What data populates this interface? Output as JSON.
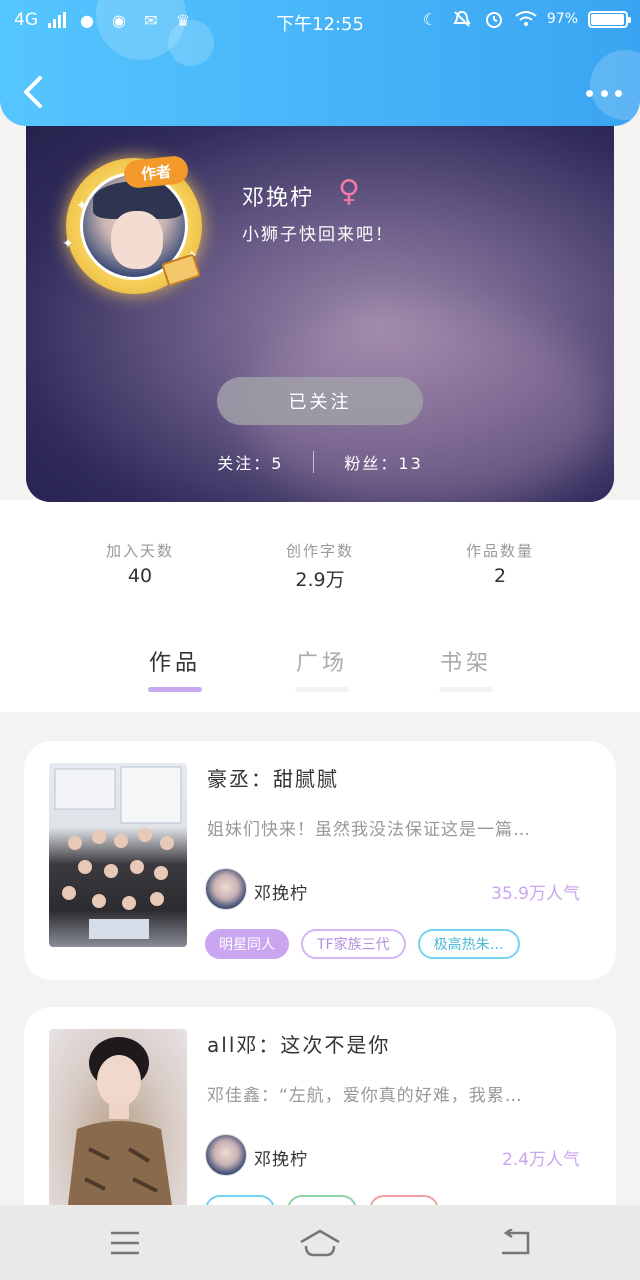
{
  "status_bar": {
    "network": "4G",
    "time": "下午12:55",
    "battery": "97%",
    "battery_level": 0.97
  },
  "header": {
    "back_icon": "chevron-left-icon",
    "more_icon": "ellipsis-icon"
  },
  "profile": {
    "author_badge": "作者",
    "name": "邓挽柠",
    "gender_symbol": "♀",
    "bio": "小狮子快回来吧！",
    "follow_button": "已关注",
    "following_label": "关注：5",
    "fans_label": "粉丝：13"
  },
  "stats": [
    {
      "label": "加入天数",
      "value": "40"
    },
    {
      "label": "创作字数",
      "value": "2.9万"
    },
    {
      "label": "作品数量",
      "value": "2"
    }
  ],
  "tabs": [
    {
      "label": "作品",
      "active": true
    },
    {
      "label": "广场",
      "active": false
    },
    {
      "label": "书架",
      "active": false
    }
  ],
  "works": [
    {
      "title": "豪丞：甜腻腻",
      "description": "姐妹们快来！虽然我没法保证这是一篇…",
      "author": "邓挽柠",
      "popularity": "35.9万人气",
      "tags": [
        {
          "label": "明星同人",
          "style": "fill"
        },
        {
          "label": "TF家族三代",
          "style": "outline-purple"
        },
        {
          "label": "极高热朱…",
          "style": "outline-cyan"
        }
      ]
    },
    {
      "title": "all邓：这次不是你",
      "description": "邓佳鑫：“左航，爱你真的好难，我累…",
      "author": "邓挽柠",
      "popularity": "2.4万人气",
      "tags": [
        {
          "label": "",
          "style": "outline-cyan"
        },
        {
          "label": "",
          "style": "outline-green"
        },
        {
          "label": "",
          "style": "outline-red"
        }
      ]
    }
  ],
  "nav": {
    "menu_icon": "menu-icon",
    "home_icon": "home-icon",
    "back_icon": "return-icon"
  },
  "colors": {
    "header_blue": "#3aa4f2",
    "accent_purple": "#c9a6ef",
    "gender_pink": "#ef7ba4"
  }
}
